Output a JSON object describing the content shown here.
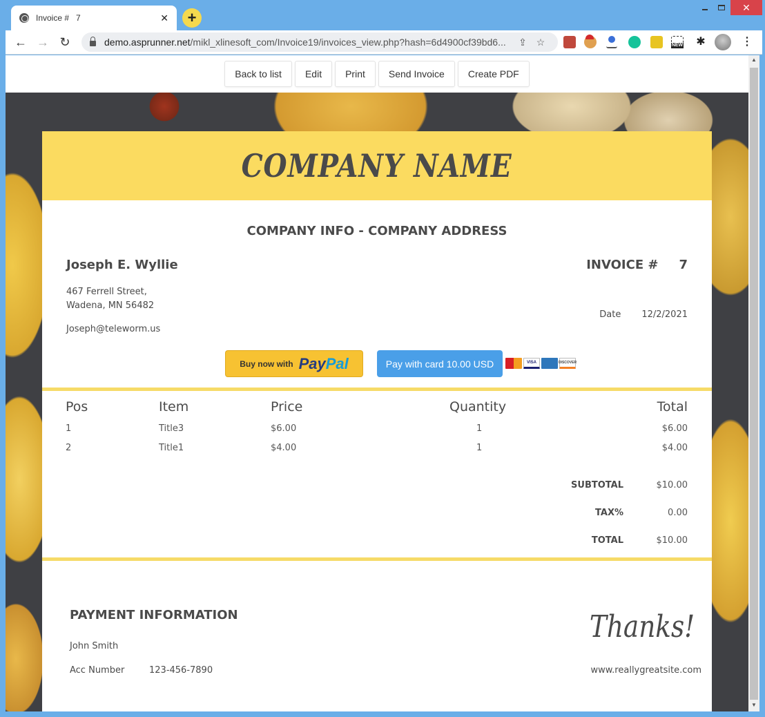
{
  "browser": {
    "tab_title": "Invoice #   7",
    "url_host": "demo.asprunner.net",
    "url_path": "/mikl_xlinesoft_com/Invoice19/invoices_view.php?hash=6d4900cf39bd6...",
    "new_tab_symbol": "+",
    "close_symbol": "✕",
    "back_symbol": "←",
    "forward_symbol": "→",
    "reload_symbol": "↻",
    "share_symbol": "⇪",
    "star_symbol": "☆",
    "puzzle_symbol": "✱",
    "menu_symbol": "⋮",
    "new_badge": "NEW",
    "window_close_symbol": "✕"
  },
  "actions": {
    "back_to_list": "Back to list",
    "edit": "Edit",
    "print": "Print",
    "send_invoice": "Send Invoice",
    "create_pdf": "Create PDF"
  },
  "invoice": {
    "company_name": "COMPANY NAME",
    "company_info": "COMPANY INFO - COMPANY ADDRESS",
    "customer": {
      "name": "Joseph E. Wyllie",
      "address_line1": "467 Ferrell Street,",
      "address_line2": "Wadena, MN 56482",
      "email": "Joseph@teleworm.us"
    },
    "invoice_label": "INVOICE #",
    "invoice_number": "7",
    "date_label": "Date",
    "date_value": "12/2/2021",
    "payment_buttons": {
      "paypal_prefix": "Buy now with",
      "paypal_pay": "Pay",
      "paypal_pal": "Pal",
      "card_button": "Pay with card 10.00 USD",
      "card_logos": [
        "mastercard",
        "VISA",
        "amex",
        "DISCOVER"
      ]
    },
    "table": {
      "headers": [
        "Pos",
        "Item",
        "Price",
        "Quantity",
        "Total"
      ],
      "rows": [
        {
          "pos": "1",
          "item": "Title3",
          "price": "$6.00",
          "quantity": "1",
          "total": "$6.00"
        },
        {
          "pos": "2",
          "item": "Title1",
          "price": "$4.00",
          "quantity": "1",
          "total": "$4.00"
        }
      ]
    },
    "totals": {
      "subtotal_label": "SUBTOTAL",
      "subtotal_value": "$10.00",
      "tax_label": "TAX%",
      "tax_value": "0.00",
      "total_label": "TOTAL",
      "total_value": "$10.00"
    },
    "payment_info": {
      "heading": "PAYMENT INFORMATION",
      "name": "John Smith",
      "acc_label": "Acc Number",
      "acc_value": "123-456-7890"
    },
    "thanks": "Thanks!",
    "website": "www.reallygreatsite.com"
  },
  "colors": {
    "banner": "#fbdb60",
    "rule": "#f6db68",
    "card_button": "#4a9fe8",
    "paypal_button": "#f7c232",
    "browser_frame": "#6aaee8"
  }
}
